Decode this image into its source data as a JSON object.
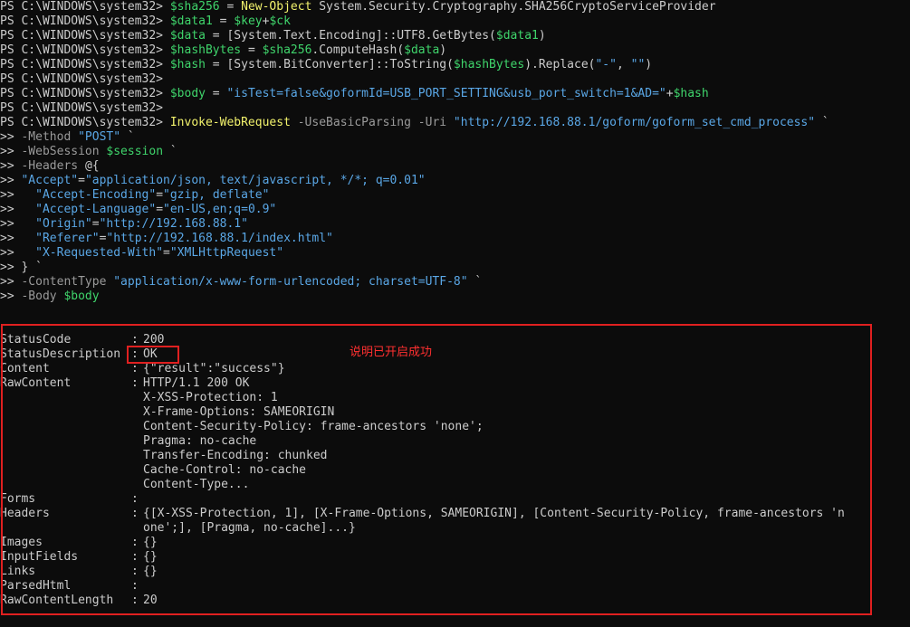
{
  "prompt": "PS C:\\WINDOWS\\system32> ",
  "cmd_lines": [
    {
      "var": "$sha256",
      "eq": " = ",
      "cmd": "New-Object",
      "rest": " System.Security.Cryptography.SHA256CryptoServiceProvider"
    },
    {
      "var": "$data1",
      "eq": " = ",
      "var2": "$key",
      "plus": "+",
      "var3": "$ck"
    },
    {
      "var": "$data",
      "eq": " = ",
      "text": "[System.Text.Encoding]::UTF8.GetBytes(",
      "var2": "$data1",
      "close": ")"
    },
    {
      "var": "$hashBytes",
      "eq": " = ",
      "var2": "$sha256",
      "text": ".ComputeHash(",
      "var3": "$data",
      "close": ")"
    },
    {
      "var": "$hash",
      "eq": " = ",
      "text": "[System.BitConverter]::ToString(",
      "var2": "$hashBytes",
      "text2": ").Replace(",
      "str1": "\"-\"",
      "comma": ", ",
      "str2": "\"\"",
      "close": ")"
    },
    {
      "empty": true
    },
    {
      "var": "$body",
      "eq": " = ",
      "str": "\"isTest=false&goformId=USB_PORT_SETTING&usb_port_switch=1&AD=\"",
      "plus": "+",
      "var2": "$hash"
    },
    {
      "empty": true
    },
    {
      "cmd": "Invoke-WebRequest",
      "param1": " -UseBasicParsing -Uri ",
      "str": "\"http://192.168.88.1/goform/goform_set_cmd_process\"",
      "tick": " `"
    }
  ],
  "continuation_prefix": ">> ",
  "cont_lines": [
    {
      "param": "-Method ",
      "str": "\"POST\"",
      "tick": " `"
    },
    {
      "param": "-WebSession ",
      "var": "$session",
      "tick": " `"
    },
    {
      "param": "-Headers ",
      "text": "@{"
    },
    {
      "str": "\"Accept\"",
      "text": "=",
      "str2": "\"application/json, text/javascript, */*; q=0.01\""
    },
    {
      "indent": "  ",
      "str": "\"Accept-Encoding\"",
      "text": "=",
      "str2": "\"gzip, deflate\""
    },
    {
      "indent": "  ",
      "str": "\"Accept-Language\"",
      "text": "=",
      "str2": "\"en-US,en;q=0.9\""
    },
    {
      "indent": "  ",
      "str": "\"Origin\"",
      "text": "=",
      "str2": "\"http://192.168.88.1\""
    },
    {
      "indent": "  ",
      "str": "\"Referer\"",
      "text": "=",
      "str2": "\"http://192.168.88.1/index.html\""
    },
    {
      "indent": "  ",
      "str": "\"X-Requested-With\"",
      "text": "=",
      "str2": "\"XMLHttpRequest\""
    },
    {
      "text": "} `"
    },
    {
      "param": "-ContentType ",
      "str": "\"application/x-www-form-urlencoded; charset=UTF-8\"",
      "tick": " `"
    },
    {
      "param": "-Body ",
      "var": "$body"
    }
  ],
  "output": [
    {
      "key": "StatusCode",
      "sep": ":",
      "val": "200"
    },
    {
      "key": "StatusDescription",
      "sep": ":",
      "val": "OK"
    },
    {
      "key": "Content",
      "sep": ":",
      "val": "{\"result\":\"success\"}"
    },
    {
      "key": "RawContent",
      "sep": ":",
      "val": "HTTP/1.1 200 OK"
    },
    {
      "key": "",
      "sep": "",
      "val": "X-XSS-Protection: 1"
    },
    {
      "key": "",
      "sep": "",
      "val": "X-Frame-Options: SAMEORIGIN"
    },
    {
      "key": "",
      "sep": "",
      "val": "Content-Security-Policy: frame-ancestors 'none';"
    },
    {
      "key": "",
      "sep": "",
      "val": "Pragma: no-cache"
    },
    {
      "key": "",
      "sep": "",
      "val": "Transfer-Encoding: chunked"
    },
    {
      "key": "",
      "sep": "",
      "val": "Cache-Control: no-cache"
    },
    {
      "key": "",
      "sep": "",
      "val": "Content-Type..."
    },
    {
      "key": "Forms",
      "sep": ":",
      "val": ""
    },
    {
      "key": "Headers",
      "sep": ":",
      "val": "{[X-XSS-Protection, 1], [X-Frame-Options, SAMEORIGIN], [Content-Security-Policy, frame-ancestors 'n"
    },
    {
      "key": "",
      "sep": "",
      "val": "one';], [Pragma, no-cache]...}"
    },
    {
      "key": "Images",
      "sep": ":",
      "val": "{}"
    },
    {
      "key": "InputFields",
      "sep": ":",
      "val": "{}"
    },
    {
      "key": "Links",
      "sep": ":",
      "val": "{}"
    },
    {
      "key": "ParsedHtml",
      "sep": ":",
      "val": ""
    },
    {
      "key": "RawContentLength",
      "sep": ":",
      "val": "20"
    }
  ],
  "annotation": "说明已开启成功",
  "colors": {
    "background": "#0c0c0c",
    "text": "#cccccc",
    "variable": "#3fd46b",
    "command": "#f2f26c",
    "string": "#5aa7e6",
    "parameter": "#9a9a9a",
    "highlight_box": "#e02020",
    "annotation": "#ff3030"
  }
}
